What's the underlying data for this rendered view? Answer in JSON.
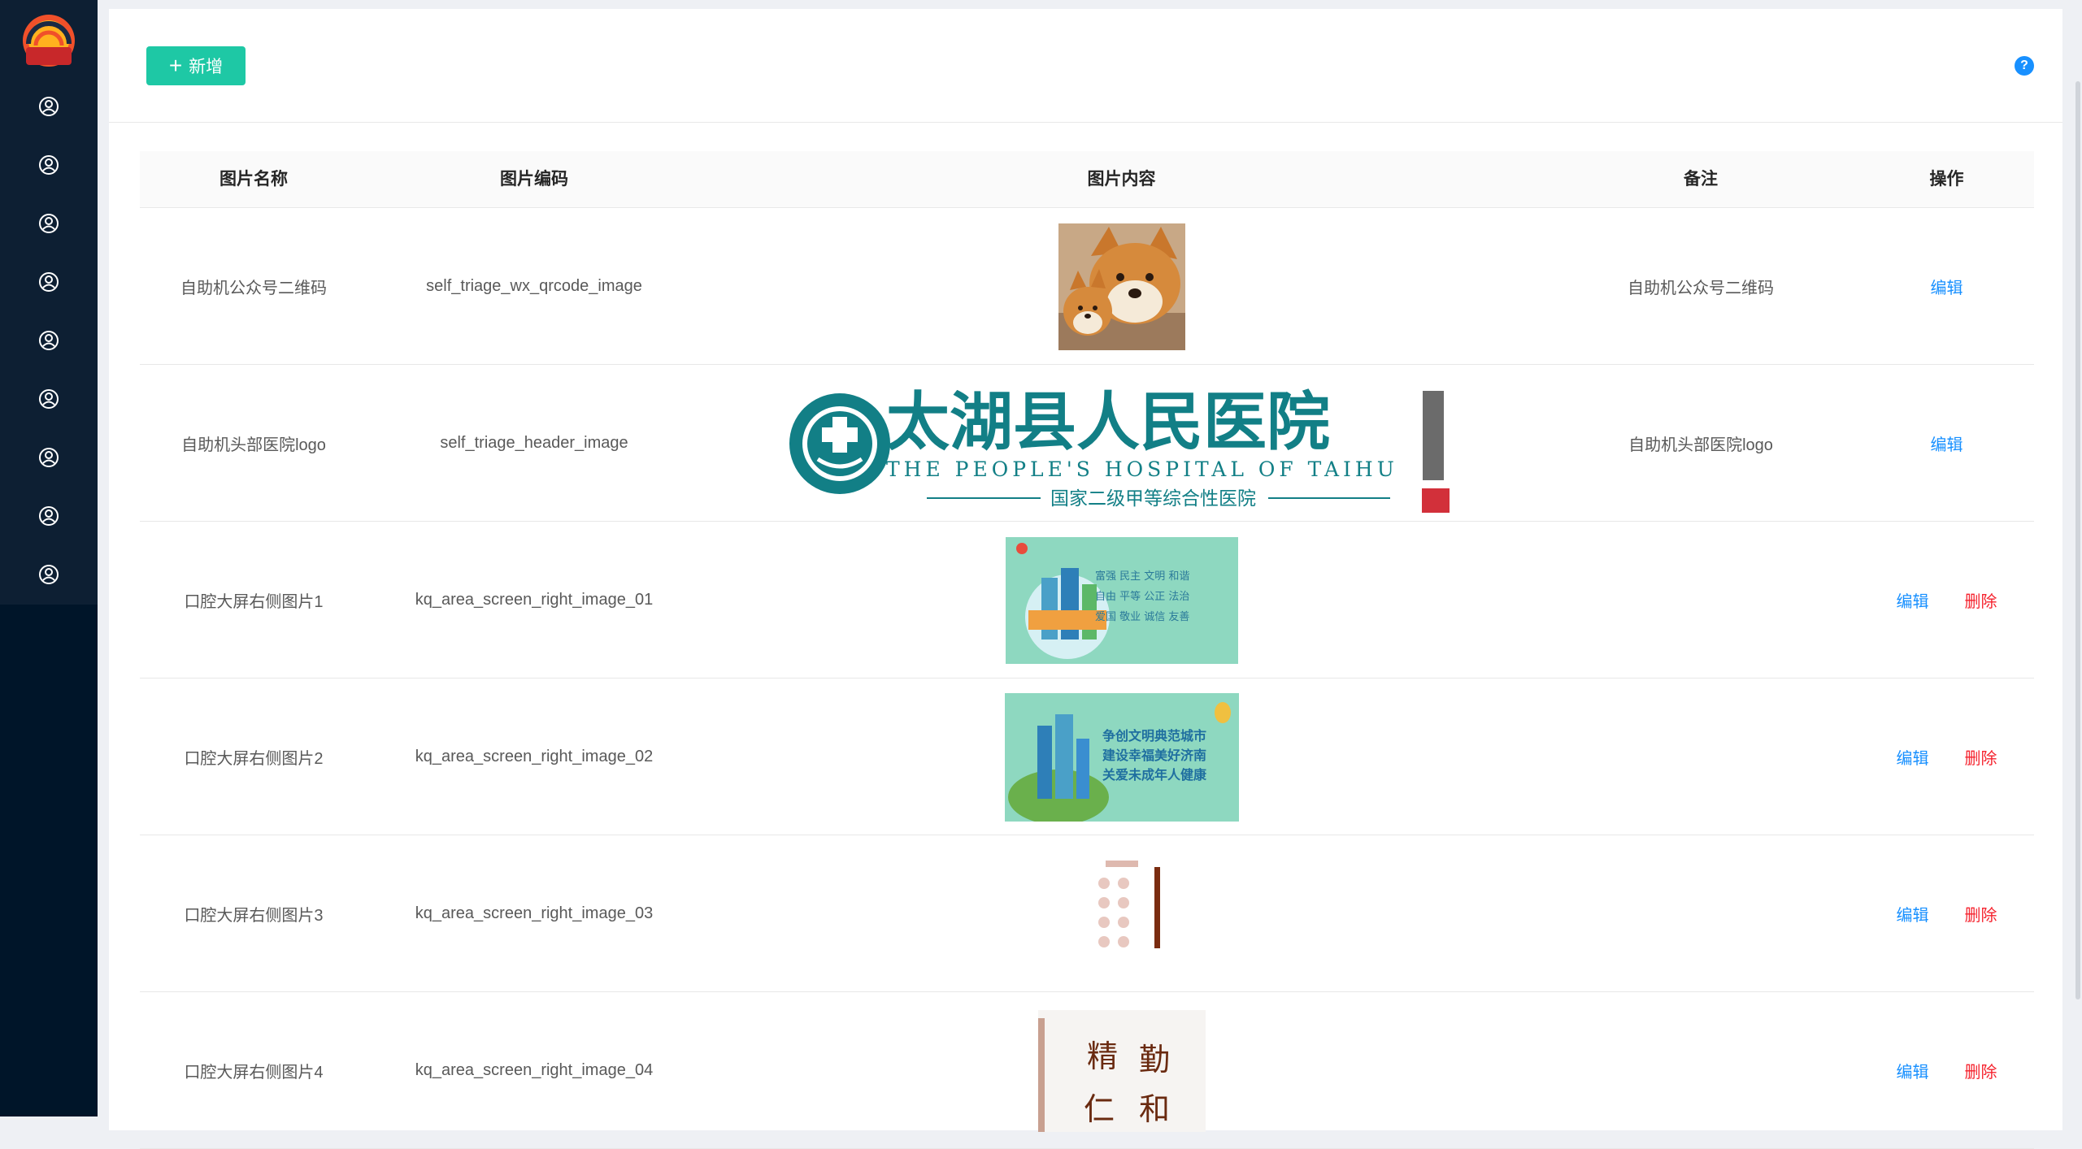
{
  "toolbar": {
    "add_label": "新增",
    "help_label": "?"
  },
  "table": {
    "headers": {
      "name": "图片名称",
      "code": "图片编码",
      "content": "图片内容",
      "note": "备注",
      "ops": "操作"
    },
    "rows": [
      {
        "name": "自助机公众号二维码",
        "code": "self_triage_wx_qrcode_image",
        "note": "自助机公众号二维码",
        "edit": "编辑",
        "delete": ""
      },
      {
        "name": "自助机头部医院logo",
        "code": "self_triage_header_image",
        "note": "自助机头部医院logo",
        "edit": "编辑",
        "delete": ""
      },
      {
        "name": "口腔大屏右侧图片1",
        "code": "kq_area_screen_right_image_01",
        "note": "",
        "edit": "编辑",
        "delete": "删除"
      },
      {
        "name": "口腔大屏右侧图片2",
        "code": "kq_area_screen_right_image_02",
        "note": "",
        "edit": "编辑",
        "delete": "删除"
      },
      {
        "name": "口腔大屏右侧图片3",
        "code": "kq_area_screen_right_image_03",
        "note": "",
        "edit": "编辑",
        "delete": "删除"
      },
      {
        "name": "口腔大屏右侧图片4",
        "code": "kq_area_screen_right_image_04",
        "note": "",
        "edit": "编辑",
        "delete": "删除"
      }
    ]
  },
  "images": {
    "logo_cn": "太湖县人民医院",
    "logo_en": "THE PEOPLE'S HOSPITAL OF TAIHU",
    "logo_grade": "国家二级甲等综合性医院",
    "banner1_lines": [
      "富强  民主  文明  和谐",
      "自由  平等  公正  法治",
      "爱国  敬业  诚信  友善"
    ],
    "banner2_lines": [
      "争创文明典范城市",
      "建设幸福美好济南",
      "关爱未成年人健康"
    ],
    "motto_chars": [
      "精",
      "勤",
      "仁",
      "和"
    ]
  },
  "colors": {
    "sidebar": "#001529",
    "primary_button": "#1ec8a5",
    "link": "#1890ff",
    "danger": "#f5222d",
    "hospital_teal": "#127f86"
  }
}
